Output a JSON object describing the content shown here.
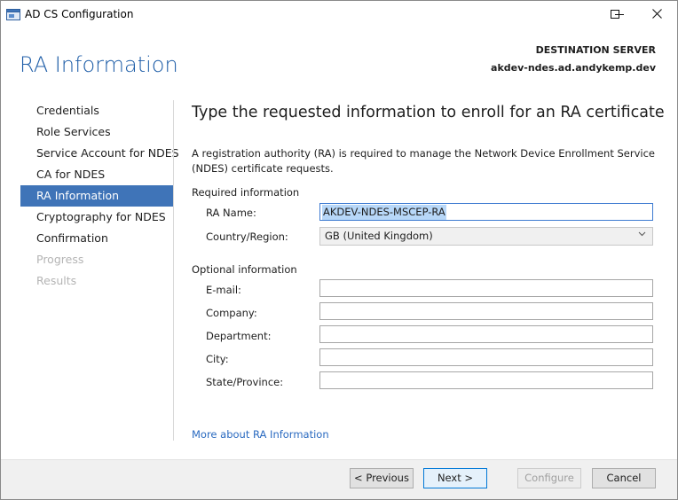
{
  "window": {
    "title": "AD CS Configuration"
  },
  "header": {
    "page_title": "RA Information",
    "destination_label": "DESTINATION SERVER",
    "destination_server": "akdev-ndes.ad.andykemp.dev"
  },
  "nav": {
    "items": [
      {
        "label": "Credentials",
        "state": "normal"
      },
      {
        "label": "Role Services",
        "state": "normal"
      },
      {
        "label": "Service Account for NDES",
        "state": "normal"
      },
      {
        "label": "CA for NDES",
        "state": "normal"
      },
      {
        "label": "RA Information",
        "state": "selected"
      },
      {
        "label": "Cryptography for NDES",
        "state": "normal"
      },
      {
        "label": "Confirmation",
        "state": "normal"
      },
      {
        "label": "Progress",
        "state": "disabled"
      },
      {
        "label": "Results",
        "state": "disabled"
      }
    ]
  },
  "content": {
    "heading": "Type the requested information to enroll for an RA certificate",
    "description": "A registration authority (RA) is required to manage the Network Device Enrollment Service (NDES) certificate requests.",
    "required_section": "Required information",
    "ra_name_label": "RA Name:",
    "ra_name_value": "AKDEV-NDES-MSCEP-RA",
    "country_label": "Country/Region:",
    "country_value": "GB (United Kingdom)",
    "optional_section": "Optional information",
    "email_label": "E-mail:",
    "email_value": "",
    "company_label": "Company:",
    "company_value": "",
    "department_label": "Department:",
    "department_value": "",
    "city_label": "City:",
    "city_value": "",
    "state_label": "State/Province:",
    "state_value": "",
    "more_link": "More about RA Information"
  },
  "footer": {
    "previous": "< Previous",
    "next": "Next >",
    "configure": "Configure",
    "cancel": "Cancel"
  },
  "colors": {
    "title_blue": "#1f5ea8",
    "selection_bg": "#3f74b8",
    "link": "#2a6ac0",
    "text_highlight": "#b7d7f8"
  }
}
